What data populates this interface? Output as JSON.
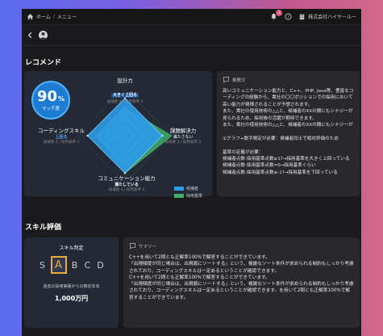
{
  "topbar": {
    "crumbs": [
      "ホーム",
      "メニュー"
    ],
    "notification_count": "1",
    "company": "株式会社ハイヤールー"
  },
  "sections": {
    "recommend_title": "レコメンド",
    "skill_title": "スキル評価"
  },
  "match": {
    "value": "90",
    "unit": "%",
    "label": "マッチ度"
  },
  "radar": {
    "axes": [
      {
        "title": "設計力",
        "status": "大きく上回る",
        "note": "候補者 4 | 採用基準 3"
      },
      {
        "title": "課題解決力",
        "status": "満たさない",
        "note": "候補者 4 | 採用基準 5"
      },
      {
        "title": "コミュニケーション能力",
        "status": "満たしている",
        "note": "候補者 4 | 採用基準 4"
      },
      {
        "title": "コーディングスキル",
        "status": "上回る",
        "note": "候補者 4 | 採用基準 3"
      }
    ],
    "legend": [
      "候補者",
      "採用基準"
    ],
    "colors": {
      "candidate": "#2b9bea",
      "standard": "#3fae6b"
    },
    "max": 5,
    "candidate": [
      4,
      4,
      4,
      4
    ],
    "standard": [
      3,
      5,
      4,
      3
    ]
  },
  "reco": {
    "title": "推薦文",
    "body": "高いコミュニケーション能力と、C++、PHP, Java等、豊富なコーディングの経験から、貴社の〇〇ポジションでの採用において高い能力が発揮されることが予想されます。\nまた、貴社の使用技術の△△と、候補者のXXの間にもシナジーが見られるため、採用後の活躍が期待できます。\nまた、貴社の使用技術の△△と、候補者のXXの間にもシナジーが\n\n①グラフ+数字規定が必要：候補者同士で相対評価のため\n\n基準の定義が必要：\n候補者点数-採用基準点数≥1?→採用基準を大きく上回っている\n候補者点数-採用基準点数=0→採用基準ぐらい\n候補者点数-採用基準点数≤-1?→採用基準を下回っている"
  },
  "skill": {
    "title": "スキル判定",
    "grades": [
      "S",
      "A",
      "B",
      "C",
      "D"
    ],
    "selected": "A",
    "note": "過去の採用実績からの推定年収",
    "amount": "1,000万円"
  },
  "summary": {
    "title": "サマリー",
    "body": "C++を用いて2問とも正解率100%で解答することができています。\n「出現頻度が同じ場合は、出現順にソートする」という、複雑なソート条件が求められる制約もしっかり考慮されており、コーディングスキルは一定あるということが確認できます。\nC++を用いて2問とも正解率100%で解答することができています。\n「出現頻度が同じ場合は、出現順にソートする」という、複雑なソート条件が求められる制約もしっかり考慮されており、コーディングスキルは一定あるということが確認できます。を用いて2問とも正解率100%で解答することができています。"
  }
}
